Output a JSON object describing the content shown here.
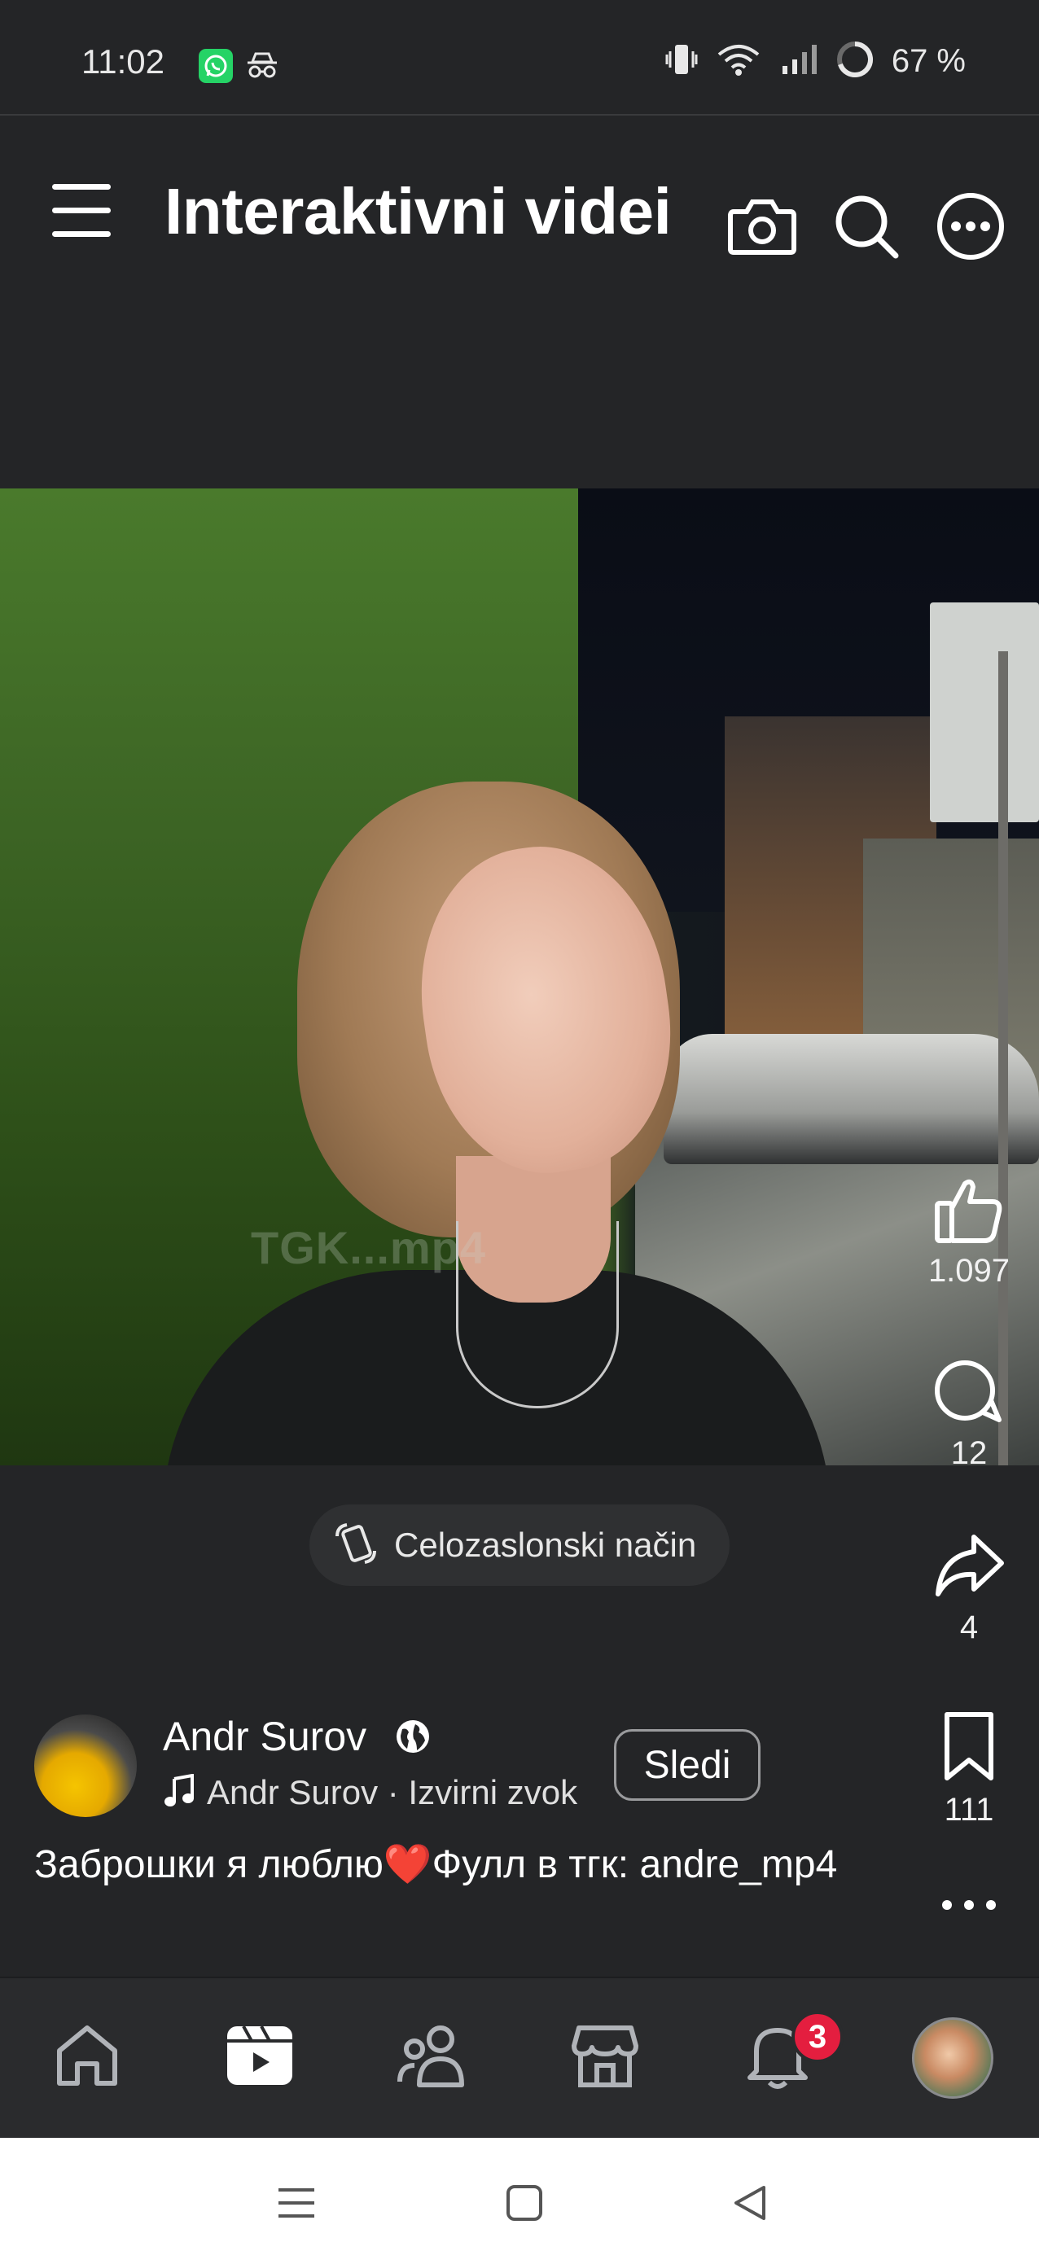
{
  "status_bar": {
    "time": "11:02",
    "battery_percent": "67 %",
    "icons": [
      "whatsapp-icon",
      "incognito-icon",
      "vibrate-icon",
      "wifi-icon",
      "signal-icon",
      "battery-icon"
    ]
  },
  "header": {
    "title": "Interaktivni videi",
    "icons": [
      "menu-icon",
      "camera-icon",
      "search-icon",
      "more-icon"
    ]
  },
  "video": {
    "watermark": "TGK...mp4"
  },
  "fullscreen_button": {
    "label": "Celozaslonski način",
    "icon": "rotate-screen-icon"
  },
  "actions": {
    "likes": "1.097",
    "comments": "12",
    "shares": "4",
    "saves": "111"
  },
  "post": {
    "author": "Andr Surov",
    "audio": "Andr Surov · Izvirni zvok",
    "follow_label": "Sledi",
    "caption": "Заброшки я люблю❤️Фулл в тгк: andre_mp4"
  },
  "bottom_nav": {
    "items": [
      "home-icon",
      "video-icon",
      "friends-icon",
      "marketplace-icon",
      "notifications-icon",
      "profile-avatar"
    ],
    "notifications_badge": "3"
  },
  "system_nav": [
    "recents-icon",
    "home-icon",
    "back-icon"
  ],
  "colors": {
    "background": "#242527",
    "nav_background": "#2a2b2d",
    "badge": "#e41e3f",
    "text": "#ffffff"
  }
}
